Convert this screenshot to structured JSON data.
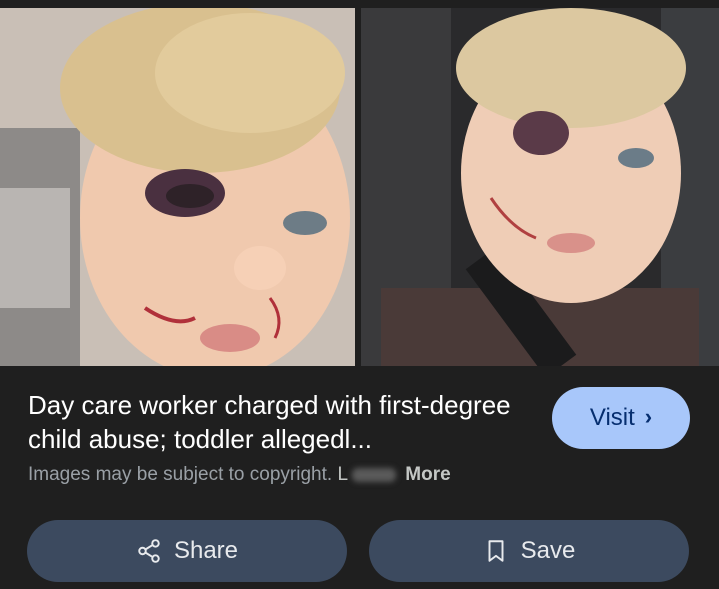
{
  "result": {
    "title": "Day care worker charged with first-degree child abuse; toddler allegedl...",
    "visit_label": "Visit",
    "copyright_text": "Images may be subject to copyright.",
    "learn_prefix": "L",
    "more_label": "More"
  },
  "actions": {
    "share_label": "Share",
    "save_label": "Save"
  },
  "icons": {
    "visit": "chevron-right-icon",
    "share": "share-icon",
    "save": "bookmark-icon"
  },
  "colors": {
    "background": "#1f1f1f",
    "visit_button": "#a8c7fa",
    "action_button": "#3c4a5f"
  }
}
